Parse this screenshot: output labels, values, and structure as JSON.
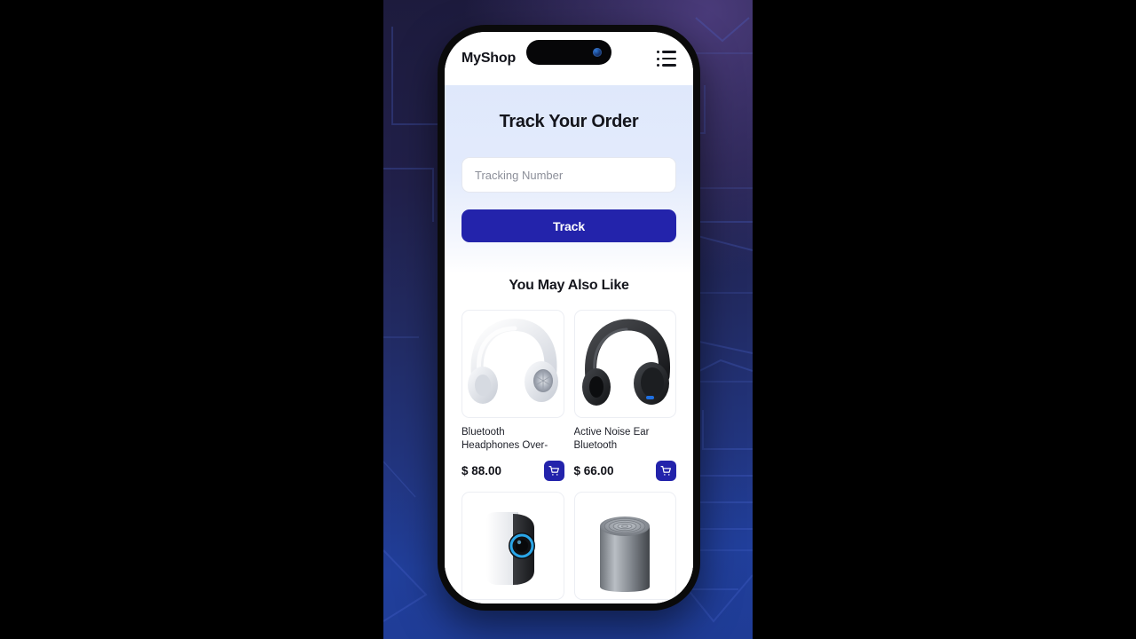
{
  "theme": {
    "accent": "#2323AB",
    "header_bg": "#FFFFFF",
    "hero_gradient_top": "#DFE8FB",
    "hero_gradient_bottom": "#FFFFFF",
    "wallpaper_top": "#1D1B3D",
    "wallpaper_bottom": "#1F3C96",
    "letterbox": "#000000",
    "text_primary": "#14151C",
    "placeholder": "#8C8F99"
  },
  "app": {
    "brand": "MyShop",
    "menu_icon": "list-menu-icon"
  },
  "status_bar": {
    "island_shape": "dynamic-island",
    "camera_icon": "camera-lens-icon"
  },
  "hero": {
    "title": "Track Your Order",
    "input": {
      "value": "",
      "placeholder": "Tracking Number",
      "name": "tracking-number"
    },
    "button_label": "Track"
  },
  "recommendations": {
    "title": "You May Also Like",
    "cart_icon": "shopping-cart-icon",
    "products": [
      {
        "name": "Bluetooth Headphones Over-Ear,Wireless Hea...",
        "price": "$ 88.00",
        "image": "white-over-ear-headphones"
      },
      {
        "name": "Active Noise Ear Bluetooth Headphones",
        "price": "$ 66.00",
        "image": "black-over-ear-headphones"
      },
      {
        "name": "",
        "price": "",
        "image": "white-black-security-camera"
      },
      {
        "name": "",
        "price": "",
        "image": "metallic-cylinder-speaker"
      }
    ]
  }
}
